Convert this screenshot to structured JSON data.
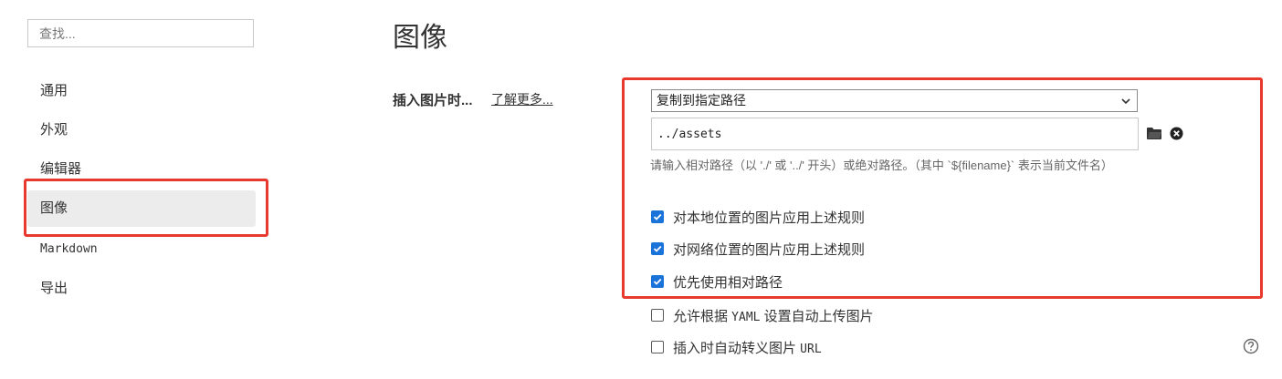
{
  "search": {
    "placeholder": "查找..."
  },
  "sidebar": {
    "items": [
      {
        "label": "通用"
      },
      {
        "label": "外观"
      },
      {
        "label": "编辑器"
      },
      {
        "label": "图像"
      },
      {
        "label": "Markdown"
      },
      {
        "label": "导出"
      }
    ]
  },
  "main": {
    "title": "图像",
    "setting_label": "插入图片时...",
    "learn_more": "了解更多...",
    "select_value": "复制到指定路径",
    "path_value": "../assets",
    "hint": "请输入相对路径（以 './' 或 '../' 开头）或绝对路径。（其中 `${filename}` 表示当前文件名）",
    "options": [
      {
        "label": "对本地位置的图片应用上述规则",
        "checked": true
      },
      {
        "label": "对网络位置的图片应用上述规则",
        "checked": true
      },
      {
        "label": "优先使用相对路径",
        "checked": true
      },
      {
        "label_parts": [
          "允许根据 ",
          "YAML",
          " 设置自动上传图片"
        ],
        "checked": false
      },
      {
        "label_parts": [
          "插入时自动转义图片 ",
          "URL"
        ],
        "checked": false
      }
    ]
  },
  "colors": {
    "highlight_border": "#e8392f",
    "checkbox_blue": "#1a73d9",
    "active_nav_bg": "#ececec"
  }
}
